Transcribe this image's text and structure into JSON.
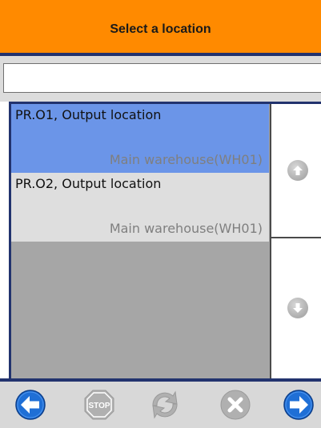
{
  "header": {
    "title": "Select a location"
  },
  "search": {
    "value": "",
    "placeholder": ""
  },
  "list": {
    "items": [
      {
        "title": "PR.O1, Output location",
        "subtitle": "Main warehouse(WH01)",
        "selected": true
      },
      {
        "title": "PR.O2, Output location",
        "subtitle": "Main warehouse(WH01)",
        "selected": false
      }
    ]
  },
  "scroll": {
    "up_icon": "arrow-up-circle-icon",
    "down_icon": "arrow-down-circle-icon"
  },
  "toolbar": {
    "buttons": [
      {
        "icon": "back-arrow-icon",
        "enabled": true
      },
      {
        "icon": "stop-icon",
        "label": "STOP",
        "enabled": false
      },
      {
        "icon": "refresh-icon",
        "enabled": false
      },
      {
        "icon": "cancel-icon",
        "enabled": false
      },
      {
        "icon": "forward-arrow-icon",
        "enabled": true
      }
    ]
  },
  "colors": {
    "header": "#ff8a00",
    "accent_rule": "#22336e",
    "selected_row": "#6b95e8",
    "row": "#dedede",
    "list_bg": "#a6a6a6",
    "nav_blue": "#1f6fd6",
    "disabled_gray": "#b0b0b0"
  }
}
